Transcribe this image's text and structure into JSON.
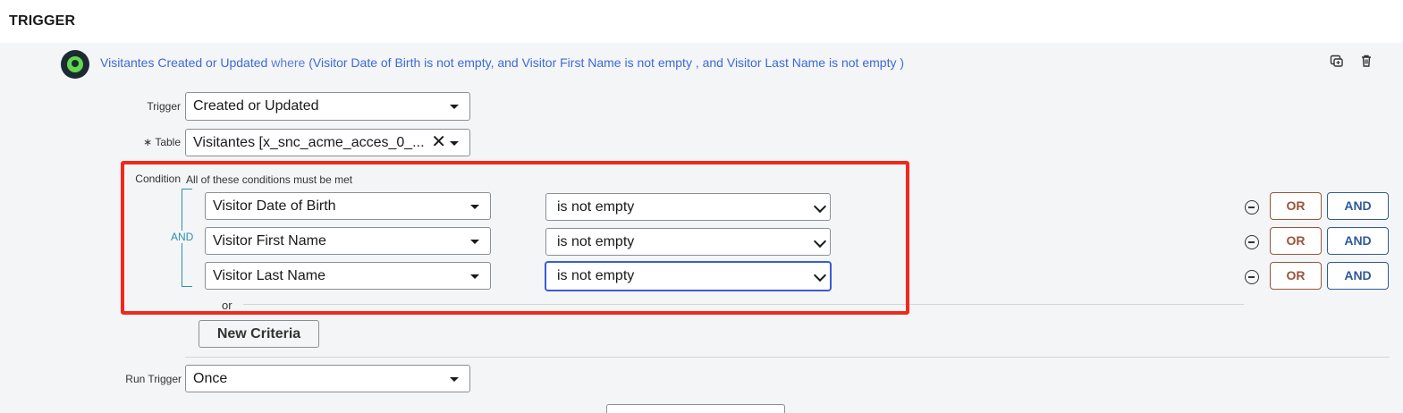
{
  "header": {
    "title": "TRIGGER"
  },
  "summary": {
    "prefix": "Visitantes Created or Updated",
    "where": "where",
    "conditions": "(Visitor Date of Birth is not empty, and Visitor First Name is not empty , and Visitor Last Name is not empty )"
  },
  "form": {
    "trigger_label": "Trigger",
    "trigger_value": "Created or Updated",
    "table_required_mark": "∗",
    "table_label": "Table",
    "table_value": "Visitantes [x_snc_acme_acces_0_...",
    "condition_label": "Condition",
    "condition_hint": "All of these conditions must be met",
    "and_tag": "AND",
    "conditions": [
      {
        "field": "Visitor Date of Birth",
        "operator": "is not empty"
      },
      {
        "field": "Visitor First Name",
        "operator": "is not empty"
      },
      {
        "field": "Visitor Last Name",
        "operator": "is not empty"
      }
    ],
    "or_button": "OR",
    "and_button": "AND",
    "or_separator": "or",
    "new_criteria": "New Criteria",
    "run_trigger_label": "Run Trigger",
    "run_trigger_value": "Once"
  },
  "icons": {
    "trigger": "trigger-status-icon",
    "duplicate": "duplicate-icon",
    "delete": "trash-icon",
    "remove": "minus-circle-icon",
    "clear": "close-icon",
    "dropdown": "chevron-down-icon"
  },
  "colors": {
    "highlight_box": "#f0291a",
    "link_blue": "#3c6ad6",
    "or_color": "#9b5439",
    "and_color": "#2f5a97",
    "status_green": "#62d84e"
  }
}
